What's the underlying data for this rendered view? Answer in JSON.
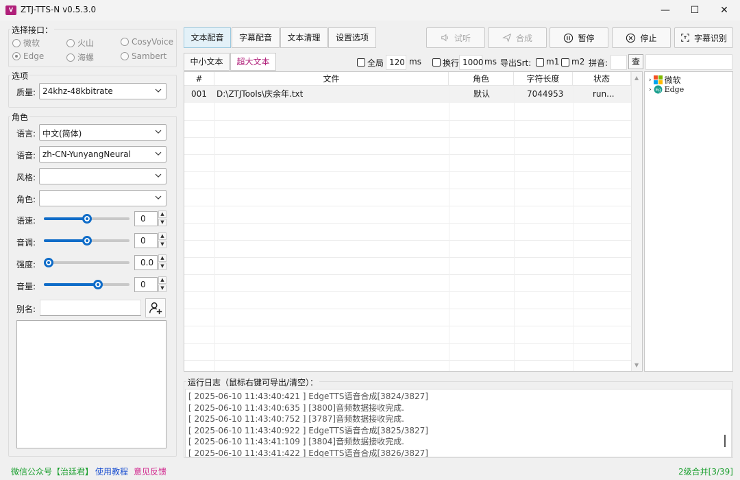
{
  "window": {
    "title": "ZTJ-TTS-N v0.5.3.0",
    "minimize": "—",
    "maximize": "☐",
    "close": "✕"
  },
  "interface_group": {
    "label": "选择接口：",
    "options": [
      {
        "label": "微软",
        "selected": false
      },
      {
        "label": "火山",
        "selected": false
      },
      {
        "label": "CosyVoice",
        "selected": false
      },
      {
        "label": "Edge",
        "selected": true
      },
      {
        "label": "海螺",
        "selected": false
      },
      {
        "label": "Sambert",
        "selected": false
      }
    ]
  },
  "options_group": {
    "label": "选项",
    "quality_label": "质量:",
    "quality_value": "24khz-48kbitrate"
  },
  "role_group": {
    "label": "角色",
    "language_label": "语言:",
    "language_value": "中文(简体)",
    "voice_label": "语音:",
    "voice_value": "zh-CN-YunyangNeural",
    "style_label": "风格:",
    "style_value": "",
    "role_label": "角色:",
    "role_value": "",
    "sliders": [
      {
        "label": "语速:",
        "value": "0",
        "fraction": 0.5
      },
      {
        "label": "音调:",
        "value": "0",
        "fraction": 0.5
      },
      {
        "label": "强度:",
        "value": "0.0",
        "fraction": 0.0
      },
      {
        "label": "音量:",
        "value": "0",
        "fraction": 0.65
      }
    ],
    "alias_label": "别名:",
    "alias_value": ""
  },
  "tabs": [
    "文本配音",
    "字幕配音",
    "文本清理",
    "设置选项"
  ],
  "actions": {
    "listen": "试听",
    "synth": "合成",
    "pause": "暂停",
    "stop": "停止",
    "subtitle_recog": "字幕识别"
  },
  "subtabs": [
    "中小文本",
    "超大文本"
  ],
  "toolbar": {
    "global_label": "全局",
    "global_value": "120",
    "ms1": "ms",
    "newline_label": "换行",
    "newline_value": "1000",
    "ms2": "ms",
    "export_srt": "导出Srt:",
    "m1": "m1",
    "m2": "m2",
    "pinyin_label": "拼音:",
    "pinyin_value": "",
    "lookup": "查",
    "lookup_input": ""
  },
  "table": {
    "headers": [
      "#",
      "文件",
      "角色",
      "字符长度",
      "状态"
    ],
    "rows": [
      {
        "num": "001",
        "file": "D:\\ZTJTools\\庆余年.txt",
        "role": "默认",
        "length": "7044953",
        "status": "run..."
      }
    ]
  },
  "tree": [
    {
      "label": "微软",
      "icon": "microsoft-logo"
    },
    {
      "label": "Edge",
      "icon": "edge-logo"
    }
  ],
  "log": {
    "label": "运行日志（鼠标右键可导出/清空）：",
    "lines": [
      "[ 2025-06-10 11:43:40:421 ] EdgeTTS语音合成[3824/3827]",
      "[ 2025-06-10 11:43:40:635 ] [3800]音频数据接收完成.",
      "[ 2025-06-10 11:43:40:752 ] [3787]音频数据接收完成.",
      "[ 2025-06-10 11:43:40:922 ] EdgeTTS语音合成[3825/3827]",
      "[ 2025-06-10 11:43:41:109 ] [3804]音频数据接收完成.",
      "[ 2025-06-10 11:43:41:422 ] EdgeTTS语音合成[3826/3827]"
    ]
  },
  "status": {
    "wechat": "微信公众号【治廷君】",
    "tutorial": "使用教程",
    "feedback": "意见反馈",
    "merge": "2级合并[3/39]"
  },
  "colors": {
    "accent": "#0f6cc8",
    "brand": "#b0207a",
    "green": "#1a9f2e",
    "link": "#1a4fd0",
    "magenta": "#d0208a"
  }
}
